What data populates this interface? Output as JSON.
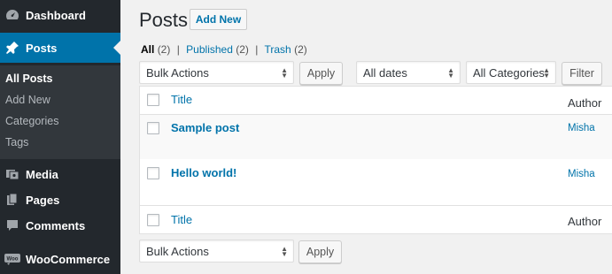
{
  "sidebar": {
    "items": [
      {
        "label": "Dashboard",
        "icon": "dashboard-icon"
      },
      {
        "label": "Posts",
        "icon": "pin-icon"
      },
      {
        "label": "Media",
        "icon": "media-icon"
      },
      {
        "label": "Pages",
        "icon": "pages-icon"
      },
      {
        "label": "Comments",
        "icon": "comments-icon"
      },
      {
        "label": "WooCommerce",
        "icon": "woocommerce-icon"
      }
    ],
    "submenu": [
      "All Posts",
      "Add New",
      "Categories",
      "Tags"
    ],
    "accent": "#0073aa",
    "bg": "#23282d"
  },
  "header": {
    "title": "Posts",
    "add_new": "Add New"
  },
  "views": {
    "all": "All",
    "all_count": "(2)",
    "published": "Published",
    "published_count": "(2)",
    "trash": "Trash",
    "trash_count": "(2)",
    "sep": "|"
  },
  "filters": {
    "bulk_actions": "Bulk Actions",
    "apply": "Apply",
    "dates": "All dates",
    "categories": "All Categories",
    "filter": "Filter"
  },
  "table": {
    "col_title": "Title",
    "col_author": "Author",
    "rows": [
      {
        "title": "Sample post",
        "author": "Misha"
      },
      {
        "title": "Hello world!",
        "author": "Misha"
      }
    ]
  },
  "footer": {
    "bulk_actions": "Bulk Actions",
    "apply": "Apply"
  }
}
